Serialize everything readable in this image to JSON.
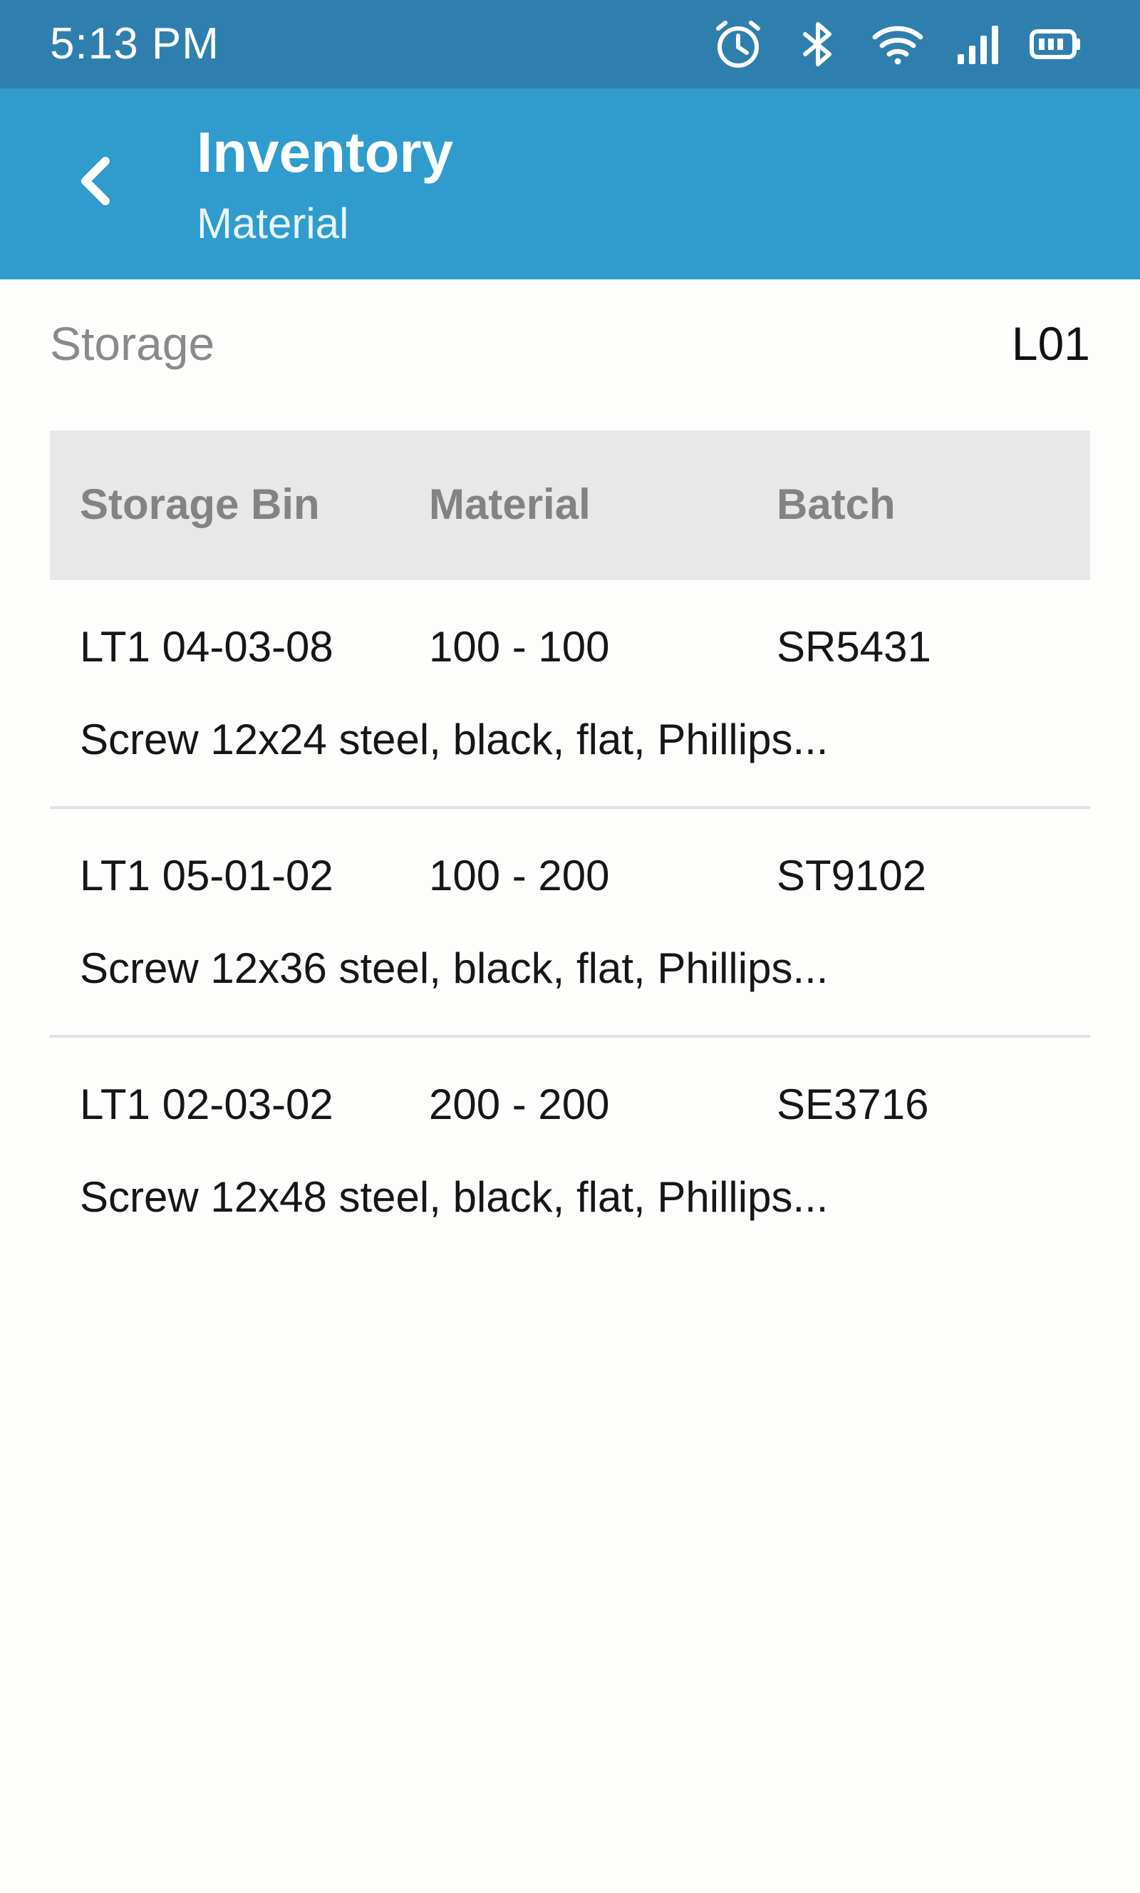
{
  "status_bar": {
    "time": "5:13 PM",
    "icons": [
      "alarm-icon",
      "bluetooth-icon",
      "wifi-icon",
      "signal-icon",
      "battery-icon"
    ]
  },
  "app_bar": {
    "title": "Inventory",
    "subtitle": "Material",
    "back_icon": "chevron-left-icon"
  },
  "storage": {
    "label": "Storage",
    "value": "L01"
  },
  "table": {
    "headers": {
      "storage_bin": "Storage Bin",
      "material": "Material",
      "batch": "Batch"
    },
    "rows": [
      {
        "storage_bin": "LT1 04-03-08",
        "material": "100 - 100",
        "batch": "SR5431",
        "description": "Screw 12x24 steel, black, flat, Phillips..."
      },
      {
        "storage_bin": "LT1 05-01-02",
        "material": "100 - 200",
        "batch": "ST9102",
        "description": "Screw 12x36 steel, black, flat, Phillips..."
      },
      {
        "storage_bin": "LT1 02-03-02",
        "material": "200 - 200",
        "batch": "SE3716",
        "description": "Screw 12x48 steel, black, flat, Phillips..."
      }
    ]
  },
  "colors": {
    "status_bar": "#2f7fae",
    "app_bar": "#2f9ccd",
    "header_background": "#e8e8e8",
    "divider": "#e1e1e1"
  }
}
